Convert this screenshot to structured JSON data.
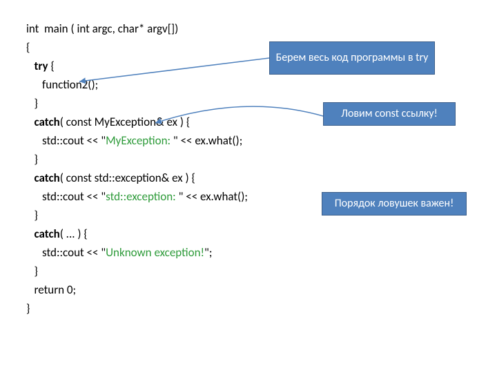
{
  "code": {
    "sig_pre": "int  main ( int argc, char* argv[])",
    "obrace": "{",
    "try": "try",
    "try_brace": " {",
    "fn2": "      function2();",
    "cbrace1": "   }",
    "catch": "catch",
    "catch1_args": "( const MyException& ex ) {",
    "cout_pre": "      std::cout << \"",
    "myex_str": "MyException: ",
    "cout_mid": "\" << ex.what();",
    "cbrace2": "   }",
    "catch2_args": "( const std::exception& ex ) {",
    "stdex_str": "std::exception: ",
    "cbrace3": "   }",
    "catch3_args": "( ... ) {",
    "unk_str": "Unknown exception!",
    "cout_end_q": "\";",
    "cbrace4": "   }",
    "ret": "   return 0;",
    "cbrace_main": "}"
  },
  "callouts": {
    "c1": "Берем весь код программы в try",
    "c2": "Ловим const ссылку!",
    "c3": "Порядок ловушек важен!"
  }
}
